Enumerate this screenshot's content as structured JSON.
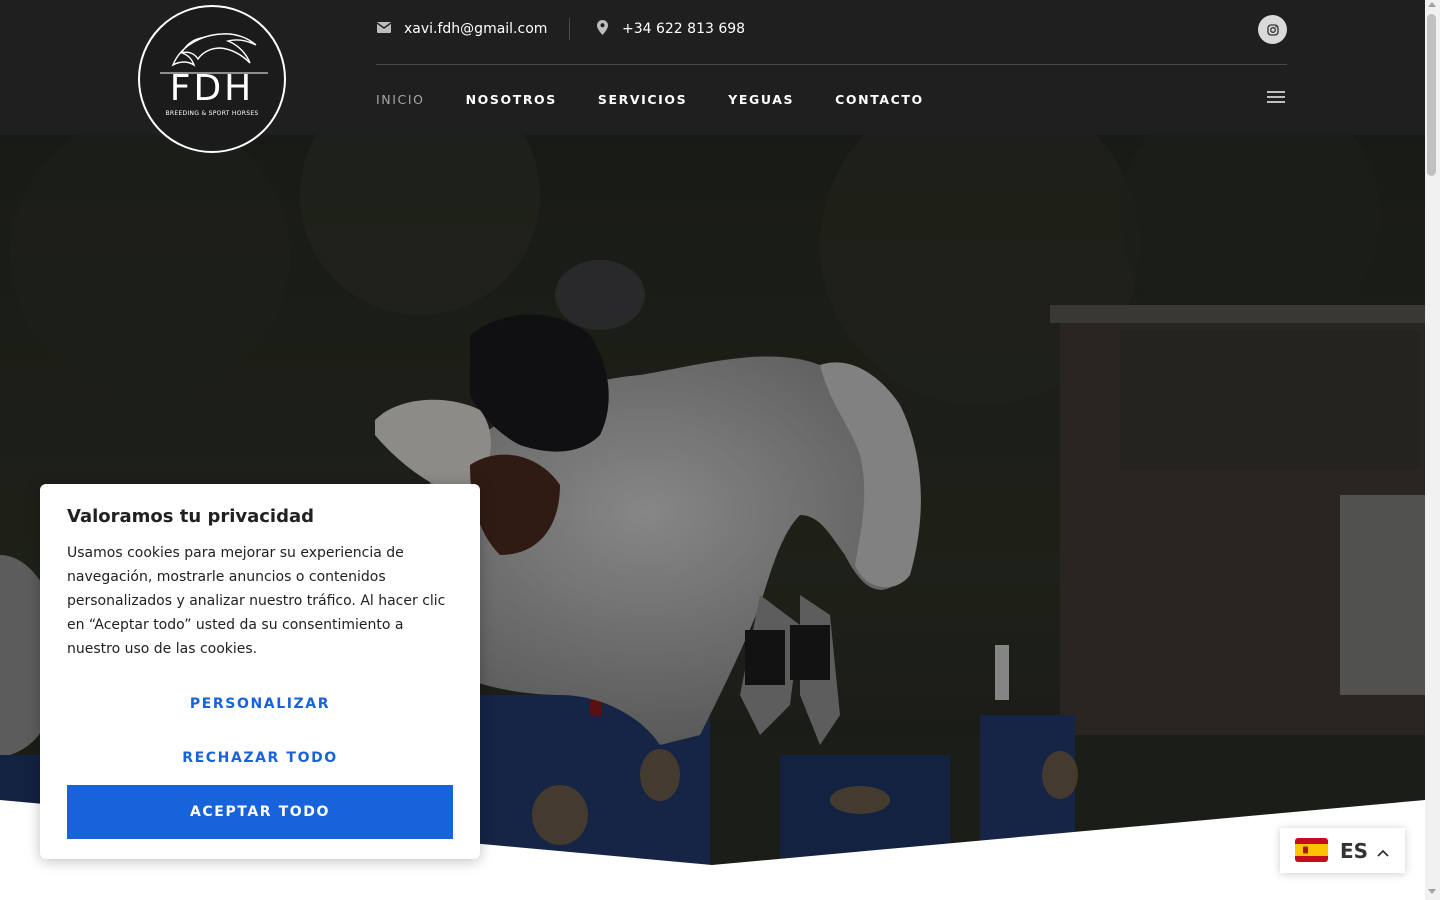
{
  "header": {
    "logo": {
      "main": "FDH",
      "sub": "BREEDING & SPORT HORSES"
    },
    "email": "xavi.fdh@gmail.com",
    "phone": "+34 622 813 698",
    "icons": {
      "email": "envelope-icon",
      "phone": "map-pin-icon",
      "social": "instagram-icon",
      "menu": "hamburger-icon"
    }
  },
  "nav": {
    "items": [
      {
        "label": "INICIO",
        "active": true
      },
      {
        "label": "NOSOTROS",
        "active": false
      },
      {
        "label": "SERVICIOS",
        "active": false
      },
      {
        "label": "YEGUAS",
        "active": false
      },
      {
        "label": "CONTACTO",
        "active": false
      }
    ]
  },
  "hero": {
    "image": "show-jumping-rider-on-grey-horse"
  },
  "cookie": {
    "title": "Valoramos tu privacidad",
    "text": "Usamos cookies para mejorar su experiencia de navegación, mostrarle anuncios o contenidos personalizados y analizar nuestro tráfico. Al hacer clic en “Aceptar todo” usted da su consentimiento a nuestro uso de las cookies.",
    "customize_label": "PERSONALIZAR",
    "reject_label": "RECHAZAR TODO",
    "accept_label": "ACEPTAR TODO"
  },
  "language": {
    "code": "ES",
    "flag": "spain-flag-icon"
  },
  "colors": {
    "header_bg": "#1f1f1f",
    "accent_blue": "#1863dc",
    "nav_active": "#a6a6a6"
  }
}
